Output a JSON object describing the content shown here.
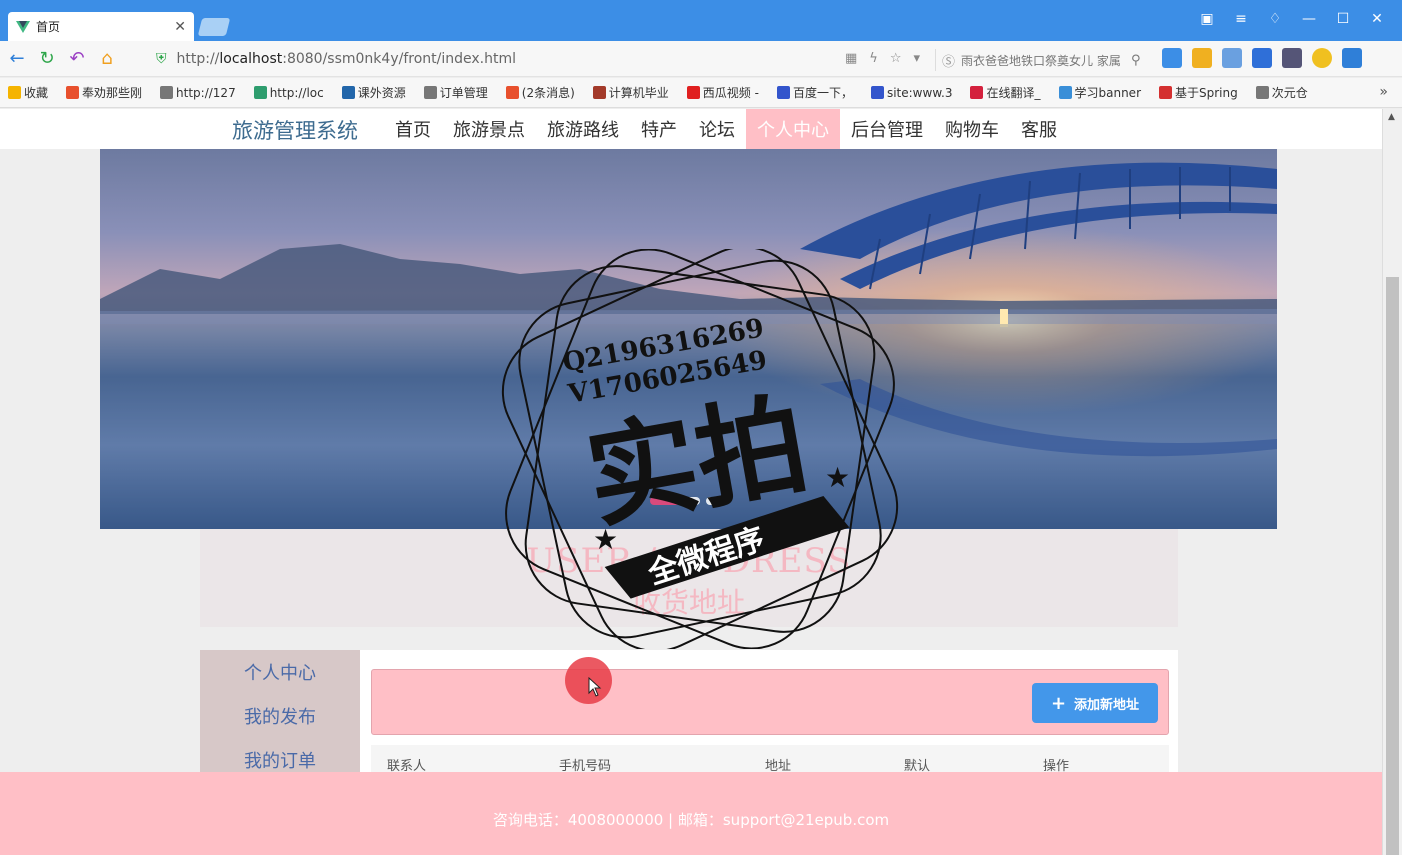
{
  "browser": {
    "tab_title": "首页",
    "url_prefix": "http://",
    "url_host": "localhost",
    "url_rest": ":8080/ssm0nk4y/front/index.html",
    "search_text": "雨衣爸爸地铁口祭奠女儿 家属",
    "bookmarks": [
      {
        "label": "收藏",
        "color": "#f5b400"
      },
      {
        "label": "奉劝那些刚",
        "color": "#e8502d"
      },
      {
        "label": "http://127",
        "color": "#777777"
      },
      {
        "label": "http://loc",
        "color": "#2e9d6e"
      },
      {
        "label": "课外资源",
        "color": "#2266aa"
      },
      {
        "label": "订单管理",
        "color": "#777777"
      },
      {
        "label": "(2条消息)",
        "color": "#e8502d"
      },
      {
        "label": "计算机毕业",
        "color": "#a33a2a"
      },
      {
        "label": "西瓜视频 -",
        "color": "#e02020"
      },
      {
        "label": "百度一下，",
        "color": "#3355cc"
      },
      {
        "label": "site:www.3",
        "color": "#3355cc"
      },
      {
        "label": "在线翻译_",
        "color": "#d4213d"
      },
      {
        "label": "学习banner",
        "color": "#3a8fd8"
      },
      {
        "label": "基于Spring",
        "color": "#d43030"
      },
      {
        "label": "次元仓",
        "color": "#777777"
      }
    ]
  },
  "site": {
    "title": "旅游管理系统",
    "menu": [
      "首页",
      "旅游景点",
      "旅游路线",
      "特产",
      "论坛",
      "个人中心",
      "后台管理",
      "购物车",
      "客服"
    ],
    "active_menu_index": 5,
    "slider_dots": 3,
    "active_dot_index": 0
  },
  "watermark": {
    "line1": "Q2196316269",
    "line2": "V1706025649",
    "big": "实拍",
    "ribbon": "全微程序"
  },
  "section": {
    "title_en": "USER / ADDRESS",
    "title_cn": "收货地址"
  },
  "sidebar": {
    "items": [
      "个人中心",
      "我的发布",
      "我的订单"
    ]
  },
  "content": {
    "add_button": "添加新地址",
    "columns": [
      "联系人",
      "手机号码",
      "地址",
      "默认",
      "操作"
    ]
  },
  "footer": {
    "text": "咨询电话：4008000000 | 邮箱：support@21epub.com"
  },
  "colors": {
    "titlebar": "#3c8ee6",
    "pink": "#ffbfc6",
    "primary_button": "#4397ea",
    "site_title": "#3d6b8f"
  }
}
